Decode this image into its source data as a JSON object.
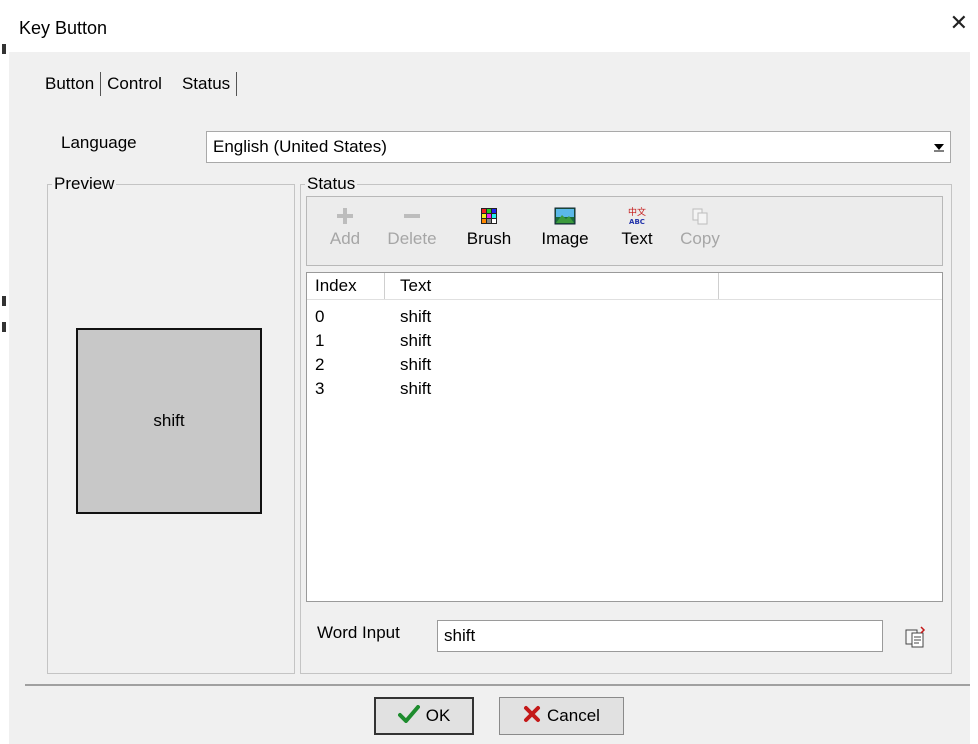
{
  "window": {
    "title": "Key Button",
    "close_glyph": "✕"
  },
  "tabs": [
    {
      "label": "Button",
      "active": false
    },
    {
      "label": "Control",
      "active": false
    },
    {
      "label": "Status",
      "active": true
    }
  ],
  "language": {
    "label": "Language",
    "value": "English (United States)"
  },
  "preview": {
    "legend": "Preview",
    "button_text": "shift",
    "button_color": "#c8c8c8"
  },
  "status": {
    "legend": "Status",
    "toolbar": [
      {
        "label": "Add",
        "icon": "plus-icon",
        "enabled": false
      },
      {
        "label": "Delete",
        "icon": "minus-icon",
        "enabled": false
      },
      {
        "label": "Brush",
        "icon": "brush-palette-icon",
        "enabled": true
      },
      {
        "label": "Image",
        "icon": "image-icon",
        "enabled": true
      },
      {
        "label": "Text",
        "icon": "text-language-icon",
        "enabled": true
      },
      {
        "label": "Copy",
        "icon": "copy-icon",
        "enabled": false
      }
    ],
    "columns": [
      "Index",
      "Text"
    ],
    "rows": [
      {
        "index": "0",
        "text": "shift"
      },
      {
        "index": "1",
        "text": "shift"
      },
      {
        "index": "2",
        "text": "shift"
      },
      {
        "index": "3",
        "text": "shift"
      }
    ]
  },
  "word_input": {
    "label": "Word Input",
    "value": "shift",
    "icon": "copy-text-icon"
  },
  "buttons": {
    "ok": "OK",
    "cancel": "Cancel"
  },
  "colors": {
    "ok_check": "#1e8c2e",
    "cancel_x": "#c41818",
    "dialog_bg": "#f0f0f0"
  }
}
